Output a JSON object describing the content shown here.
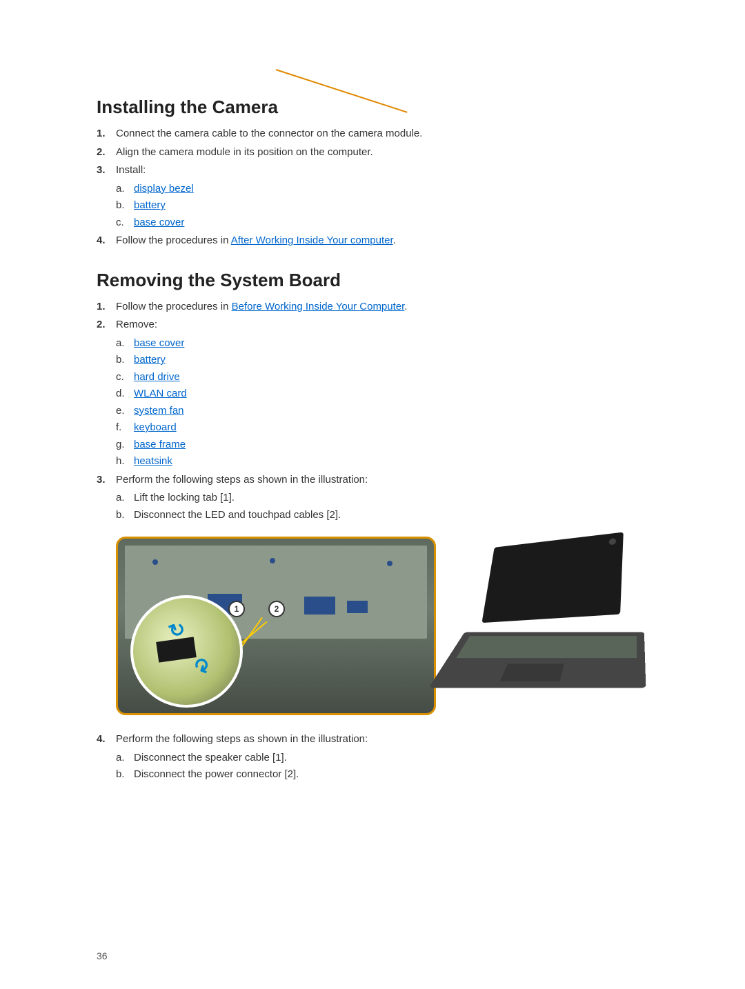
{
  "page_number": "36",
  "section1": {
    "heading": "Installing the Camera",
    "step1": "Connect the camera cable to the connector on the camera module.",
    "step2": "Align the camera module in its position on the computer.",
    "step3_intro": "Install:",
    "step3_a": "display bezel",
    "step3_b": "battery",
    "step3_c": "base cover",
    "step4_pre": "Follow the procedures in ",
    "step4_link": "After Working Inside Your computer",
    "step4_post": "."
  },
  "section2": {
    "heading": "Removing the System Board",
    "step1_pre": "Follow the procedures in ",
    "step1_link": "Before Working Inside Your Computer",
    "step1_post": ".",
    "step2_intro": "Remove:",
    "step2_a": "base cover",
    "step2_b": "battery",
    "step2_c": "hard drive",
    "step2_d": "WLAN card",
    "step2_e": "system fan",
    "step2_f": "keyboard",
    "step2_g": "base frame",
    "step2_h": "heatsink",
    "step3_intro": "Perform the following steps as shown in the illustration:",
    "step3_a": "Lift the locking tab [1].",
    "step3_b": "Disconnect the LED and touchpad cables [2].",
    "label1": "1",
    "label2": "2",
    "step4_intro": "Perform the following steps as shown in the illustration:",
    "step4_a": "Disconnect the speaker cable [1].",
    "step4_b": "Disconnect the power connector [2]."
  }
}
